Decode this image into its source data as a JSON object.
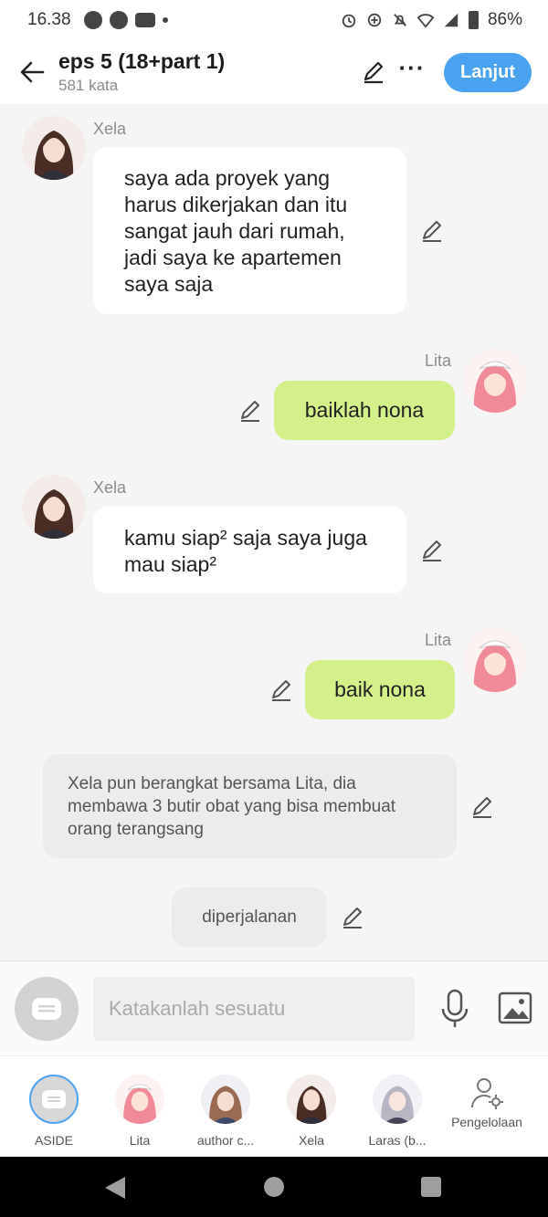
{
  "status_bar": {
    "time": "16.38",
    "battery": "86%"
  },
  "header": {
    "title": "eps 5 (18+part 1)",
    "word_count": "581 kata",
    "next_label": "Lanjut"
  },
  "messages": [
    {
      "speaker": "Xela",
      "text": "saya ada proyek yang harus dikerjakan dan itu sangat jauh dari rumah, jadi saya ke apartemen saya saja"
    },
    {
      "speaker": "Lita",
      "text": "baiklah nona"
    },
    {
      "speaker": "Xela",
      "text": "kamu siap² saja saya juga mau siap²"
    },
    {
      "speaker": "Lita",
      "text": "baik nona"
    },
    {
      "speaker": "",
      "text": "Xela pun berangkat bersama Lita, dia membawa 3 butir obat yang bisa membuat orang terangsang"
    },
    {
      "speaker": "",
      "text": "diperjalanan"
    }
  ],
  "input": {
    "placeholder": "Katakanlah sesuatu"
  },
  "characters": [
    "ASIDE",
    "Lita",
    "author c...",
    "Xela",
    "Laras (b...",
    "Pengelolaan"
  ],
  "colors": {
    "accent": "#4aa3f0",
    "green_bubble": "#d4f08a",
    "white_bubble": "#ffffff",
    "narration_bubble": "#ececec"
  },
  "icons": [
    "back-arrow-icon",
    "pencil-icon",
    "more-icon",
    "edit-icon",
    "mic-icon",
    "image-icon",
    "aside-chat-icon",
    "manage-user-icon"
  ]
}
